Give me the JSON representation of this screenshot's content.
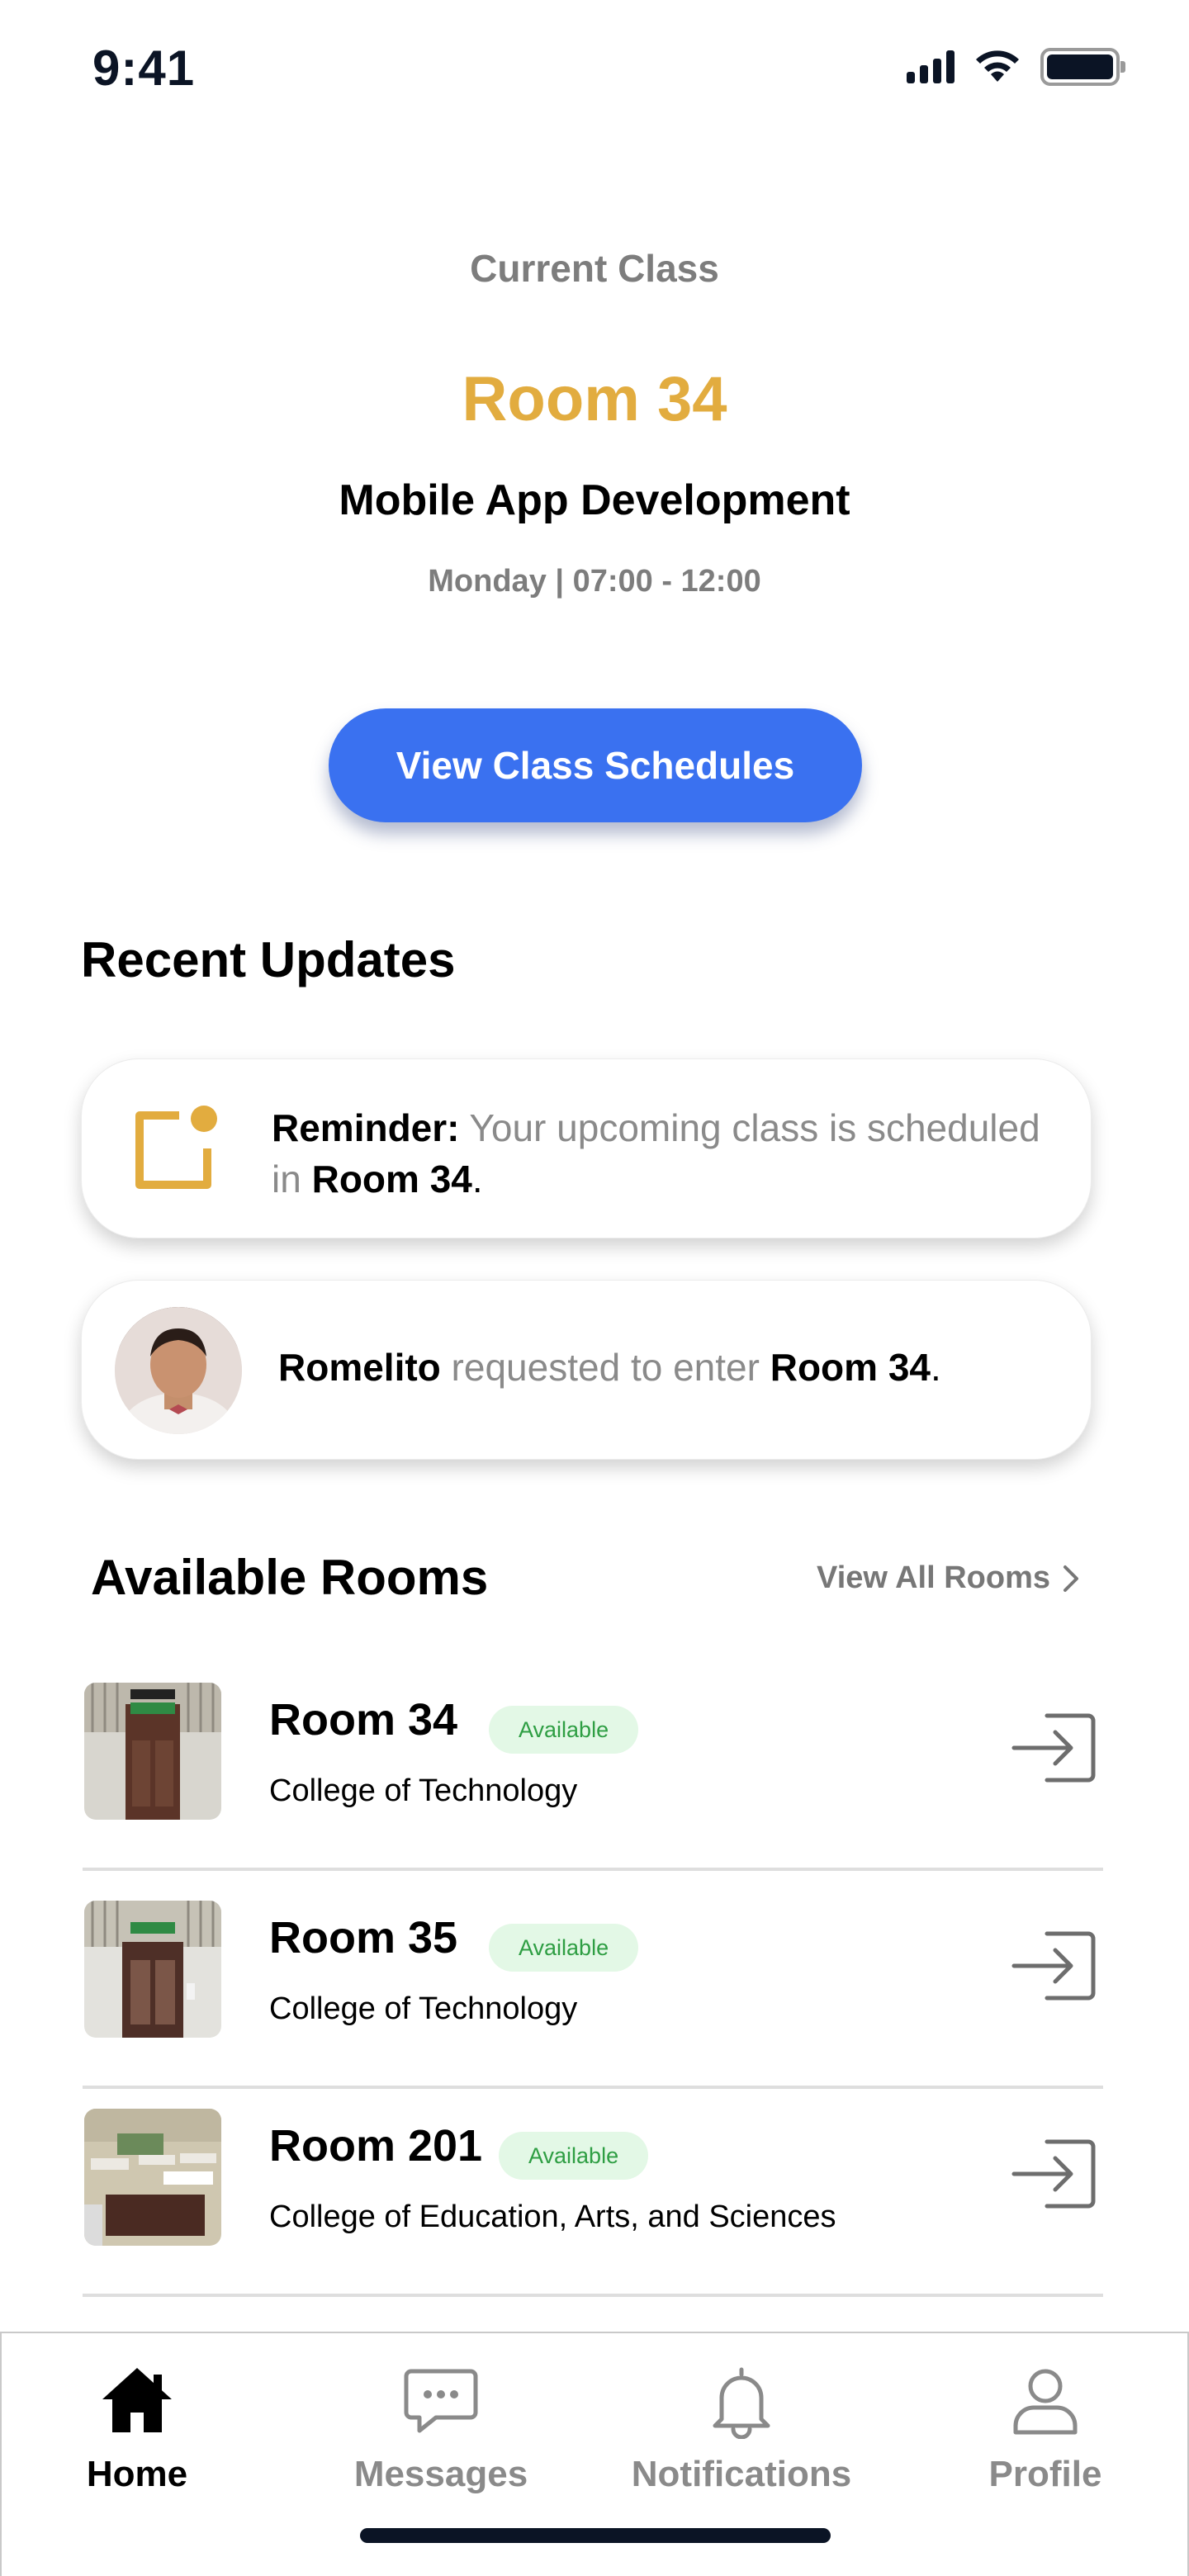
{
  "status_bar": {
    "time": "9:41"
  },
  "current_class": {
    "label": "Current Class",
    "room": "Room 34",
    "course": "Mobile App Development",
    "schedule": "Monday | 07:00 - 12:00",
    "button_label": "View Class Schedules"
  },
  "recent_updates": {
    "title": "Recent Updates",
    "reminder": {
      "prefix": "Reminder:",
      "text": " Your upcoming class is scheduled in ",
      "room": "Room 34",
      "suffix": "."
    },
    "request": {
      "name": "Romelito",
      "text": " requested to enter ",
      "room": "Room 34",
      "suffix": "."
    }
  },
  "available_rooms": {
    "title": "Available Rooms",
    "view_all_label": "View All Rooms",
    "rooms": [
      {
        "name": "Room 34",
        "status": "Available",
        "college": "College of Technology"
      },
      {
        "name": "Room 35",
        "status": "Available",
        "college": "College of Technology"
      },
      {
        "name": "Room 201",
        "status": "Available",
        "college": "College of Education, Arts, and Sciences"
      }
    ]
  },
  "bottom_nav": {
    "items": [
      {
        "label": "Home",
        "icon": "home-icon",
        "active": true
      },
      {
        "label": "Messages",
        "icon": "chat-icon",
        "active": false
      },
      {
        "label": "Notifications",
        "icon": "bell-icon",
        "active": false
      },
      {
        "label": "Profile",
        "icon": "user-icon",
        "active": false
      }
    ]
  },
  "colors": {
    "accent": "#3a71f0",
    "room_highlight": "#e2ac3f",
    "badge_bg": "#e3f8e6",
    "badge_text": "#2e9e43"
  }
}
